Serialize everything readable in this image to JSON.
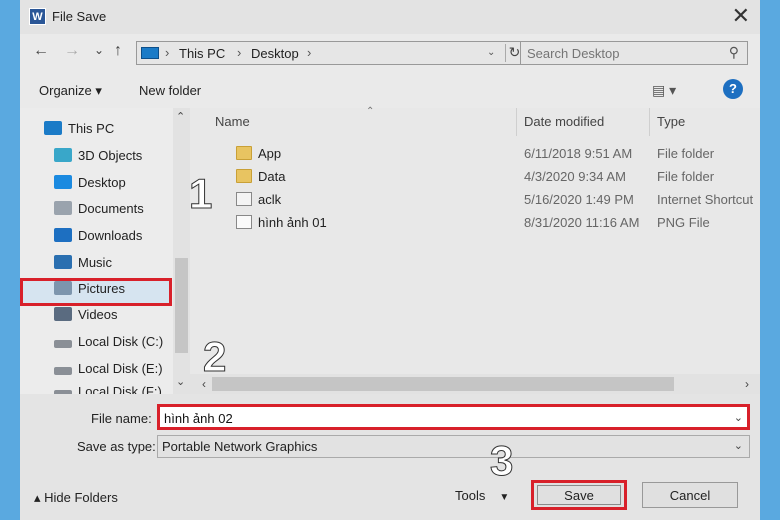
{
  "window": {
    "title": "File Save",
    "app_icon": "W",
    "close": "✕"
  },
  "nav": {
    "back": "←",
    "forward": "→",
    "recent": "⌄",
    "up": "↑",
    "breadcrumb": [
      "This PC",
      "Desktop"
    ],
    "refresh": "↻",
    "search_placeholder": "Search Desktop",
    "search_icon": "⚲"
  },
  "toolbar": {
    "organize": "Organize",
    "organize_arrow": "▾",
    "new_folder": "New folder",
    "view_icon": "▤ ▾",
    "help": "?"
  },
  "sidebar": {
    "items": [
      {
        "label": "This PC",
        "icon": "pc-icon",
        "color": "#1b7bc7"
      },
      {
        "label": "3D Objects",
        "icon": "cube-icon",
        "color": "#39a7c9"
      },
      {
        "label": "Desktop",
        "icon": "desktop-icon",
        "color": "#1b8ae0"
      },
      {
        "label": "Documents",
        "icon": "documents-icon",
        "color": "#9aa3ad"
      },
      {
        "label": "Downloads",
        "icon": "downloads-icon",
        "color": "#1d6fc1"
      },
      {
        "label": "Music",
        "icon": "music-icon",
        "color": "#2a6fb0"
      },
      {
        "label": "Pictures",
        "icon": "pictures-icon",
        "color": "#7d95ad"
      },
      {
        "label": "Videos",
        "icon": "videos-icon",
        "color": "#5a6b80"
      },
      {
        "label": "Local Disk (C:)",
        "icon": "drive-icon",
        "color": "#8a8f96"
      },
      {
        "label": "Local Disk (E:)",
        "icon": "drive-icon",
        "color": "#8a8f96"
      },
      {
        "label": "Local Disk (F:)",
        "icon": "drive-icon",
        "color": "#8a8f96"
      }
    ],
    "scroll_up": "⌃",
    "scroll_down": "⌄"
  },
  "columns": {
    "name": "Name",
    "date": "Date modified",
    "type": "Type",
    "sort": "⌃"
  },
  "files": [
    {
      "name": "App",
      "date": "6/11/2018 9:51 AM",
      "type": "File folder",
      "kind": "folder"
    },
    {
      "name": "Data",
      "date": "4/3/2020 9:34 AM",
      "type": "File folder",
      "kind": "folder"
    },
    {
      "name": "aclk",
      "date": "5/16/2020 1:49 PM",
      "type": "Internet Shortcut",
      "kind": "link"
    },
    {
      "name": "hình ảnh 01",
      "date": "8/31/2020 11:16 AM",
      "type": "PNG File",
      "kind": "png"
    }
  ],
  "hscroll": {
    "left": "‹",
    "right": "›"
  },
  "form": {
    "file_name_label": "File name:",
    "file_name_value": "hình ảnh 02",
    "save_type_label": "Save as type:",
    "save_type_value": "Portable Network Graphics",
    "dropdown": "⌄"
  },
  "footer": {
    "hide_folders": "▴  Hide Folders",
    "tools": "Tools",
    "tools_arrow": "▼",
    "save": "Save",
    "cancel": "Cancel"
  },
  "annotations": {
    "step1": "1",
    "step2": "2",
    "step3": "3",
    "highlight_color": "#d8202a"
  }
}
